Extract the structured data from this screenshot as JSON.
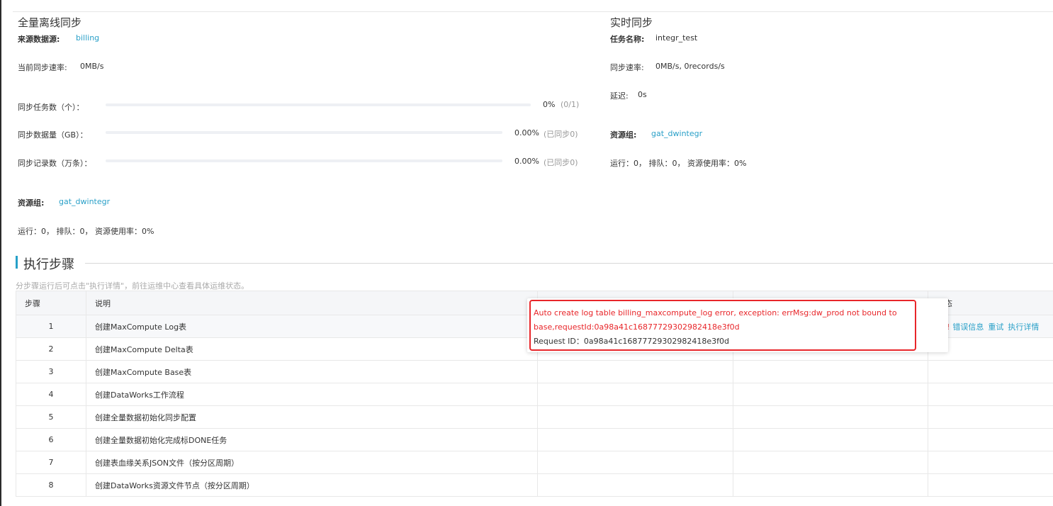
{
  "full_sync": {
    "title": "全量离线同步",
    "source_label": "来源数据源:",
    "source_value": "billing",
    "rate_label": "当前同步速率:",
    "rate_value": "0MB/s",
    "tasks_label": "同步任务数（个）：",
    "tasks_progress": 0,
    "tasks_percent": "0%",
    "tasks_detail": "(0/1)",
    "data_label": "同步数据量（GB）：",
    "data_progress": 0,
    "data_percent": "0.00%",
    "data_detail": "(已同步0)",
    "records_label": "同步记录数（万条）：",
    "records_progress": 0,
    "records_percent": "0.00%",
    "records_detail": "(已同步0)",
    "resource_label": "资源组:",
    "resource_value": "gat_dwintegr",
    "status_text": "运行：0， 排队：0， 资源使用率：0%"
  },
  "realtime_sync": {
    "title": "实时同步",
    "task_label": "任务名称:",
    "task_value": "integr_test",
    "rate_label": "同步速率:",
    "rate_value": "0MB/s, 0records/s",
    "delay_label": "延迟:",
    "delay_value": "0s",
    "resource_label": "资源组:",
    "resource_value": "gat_dwintegr",
    "status_text": "运行：0， 排队：0， 资源使用率：0%"
  },
  "steps": {
    "title": "执行步骤",
    "hint": "分步骤运行后可点击\"执行详情\"，前往运维中心查看具体运维状态。",
    "columns": {
      "step": "步骤",
      "desc": "说明",
      "status": "状态"
    },
    "rows": [
      {
        "num": "1",
        "desc": "创建MaxCompute Log表"
      },
      {
        "num": "2",
        "desc": "创建MaxCompute Delta表"
      },
      {
        "num": "3",
        "desc": "创建MaxCompute Base表"
      },
      {
        "num": "4",
        "desc": "创建DataWorks工作流程"
      },
      {
        "num": "5",
        "desc": "创建全量数据初始化同步配置"
      },
      {
        "num": "6",
        "desc": "创建全量数据初始化完成标DONE任务"
      },
      {
        "num": "7",
        "desc": "创建表血缘关系JSON文件（按分区周期）"
      },
      {
        "num": "8",
        "desc": "创建DataWorks资源文件节点（按分区周期）"
      }
    ],
    "row1_actions": {
      "error": "错误信息",
      "retry": "重试",
      "detail": "执行详情"
    }
  },
  "tooltip": {
    "error_text": "Auto create log table billing_maxcompute_log error, exception: errMsg:dw_prod not bound to base,requestId:0a98a41c16877729302982418e3f0d",
    "request_id": "Request ID：0a98a41c16877729302982418e3f0d"
  },
  "colors": {
    "accent": "#2aa0c8",
    "error": "#e8262a"
  }
}
